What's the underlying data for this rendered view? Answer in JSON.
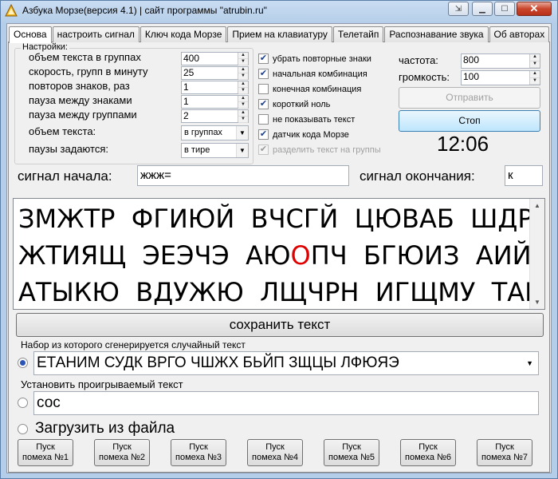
{
  "window": {
    "title": "Азбука Морзе(версия 4.1) | сайт программы \"atrubin.ru\"",
    "help_glyph": "⇲",
    "minimize_glyph": "▁",
    "maximize_glyph": "☐",
    "close_glyph": "✕"
  },
  "tabs": [
    {
      "label": "Основа",
      "active": true
    },
    {
      "label": "настроить сигнал"
    },
    {
      "label": "Ключ кода Морзе"
    },
    {
      "label": "Прием на клавиатуру"
    },
    {
      "label": "Телетайп"
    },
    {
      "label": "Распознавание звука"
    },
    {
      "label": "Об авторах"
    }
  ],
  "settings": {
    "legend": "Настройки:",
    "text_volume_groups": {
      "label": "объем текста в группах",
      "value": "400"
    },
    "groups_per_minute": {
      "label": "скорость, групп в минуту",
      "value": "25"
    },
    "char_repeats": {
      "label": "повторов знаков, раз",
      "value": "1"
    },
    "pause_chars": {
      "label": "пауза между знаками",
      "value": "1"
    },
    "pause_groups": {
      "label": "пауза между группами",
      "value": "2"
    },
    "text_volume": {
      "label": "объем текста:",
      "value": "в группах"
    },
    "pause_unit": {
      "label": "паузы задаются:",
      "value": "в тире"
    }
  },
  "checkboxes": [
    {
      "label": "убрать повторные знаки",
      "checked": true,
      "disabled": false
    },
    {
      "label": "начальная комбинация",
      "checked": true,
      "disabled": false
    },
    {
      "label": "конечная комбинация",
      "checked": false,
      "disabled": false
    },
    {
      "label": "короткий ноль",
      "checked": true,
      "disabled": false
    },
    {
      "label": "не показывать текст",
      "checked": false,
      "disabled": false
    },
    {
      "label": "датчик кода Морзе",
      "checked": true,
      "disabled": false
    },
    {
      "label": "разделить текст на группы",
      "checked": true,
      "disabled": true
    }
  ],
  "audio": {
    "frequency": {
      "label": "частота:",
      "value": "800"
    },
    "volume": {
      "label": "громкость:",
      "value": "100"
    }
  },
  "buttons": {
    "send": "Отправить",
    "stop": "Стоп",
    "save_text": "сохранить текст"
  },
  "clock": "12:06",
  "signals": {
    "start_label": "сигнал начала:",
    "start_value": "жжж=",
    "end_label": "сигнал окончания:",
    "end_value": "к"
  },
  "morse_text": {
    "line1": "ЗМЖТР  ФГИЮЙ  ВЧСГЙ  ЦЮВАБ  ШДРОВ",
    "line2_a": "ЖТИЯЩ  ЭЕЭЧЭ  АЮ",
    "line2_hl": "О",
    "line2_b": "ПЧ  БГЮИЗ  АИЙШС",
    "line3": "АТЫКЮ  ВДУЖЮ  ЛЩЧРН  ИГЩМУ  ТАЩЛП"
  },
  "random_set": {
    "label": "Набор из которого сгенерируется случайный текст",
    "value": "ЕТАНИМ СУДК ВРГО ЧШЖХ БЬЙП ЗЩЦЫ ЛФЮЯЭ",
    "selected": true
  },
  "played_text": {
    "label": "Установить проигрываемый текст",
    "value": "сос",
    "selected": false
  },
  "load_file": {
    "label": "Загрузить из файла",
    "selected": false
  },
  "noise_buttons": [
    {
      "line1": "Пуск",
      "line2": "помеха №1"
    },
    {
      "line1": "Пуск",
      "line2": "помеха №2"
    },
    {
      "line1": "Пуск",
      "line2": "помеха №3"
    },
    {
      "line1": "Пуск",
      "line2": "помеха №4"
    },
    {
      "line1": "Пуск",
      "line2": "помеха №5"
    },
    {
      "line1": "Пуск",
      "line2": "помеха №6"
    },
    {
      "line1": "Пуск",
      "line2": "помеха №7"
    }
  ],
  "colors": {
    "highlight_letter": "#e00000",
    "radio_dot": "#2a55b5",
    "stop_button": "#bee6fd"
  }
}
